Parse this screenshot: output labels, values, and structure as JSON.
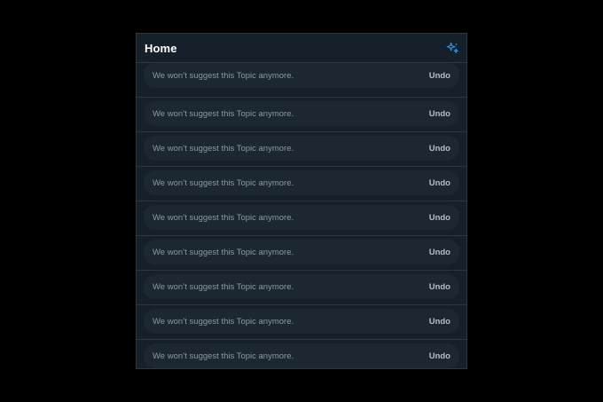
{
  "header": {
    "title": "Home",
    "sparkle_icon": "sparkle-icon",
    "accent_color": "#1d9bf0"
  },
  "notices": [
    {
      "message": "We won’t suggest this Topic anymore.",
      "action": "Undo"
    },
    {
      "message": "We won’t suggest this Topic anymore.",
      "action": "Undo"
    },
    {
      "message": "We won’t suggest this Topic anymore.",
      "action": "Undo"
    },
    {
      "message": "We won’t suggest this Topic anymore.",
      "action": "Undo"
    },
    {
      "message": "We won’t suggest this Topic anymore.",
      "action": "Undo"
    },
    {
      "message": "We won’t suggest this Topic anymore.",
      "action": "Undo"
    },
    {
      "message": "We won’t suggest this Topic anymore.",
      "action": "Undo"
    },
    {
      "message": "We won’t suggest this Topic anymore.",
      "action": "Undo"
    },
    {
      "message": "We won’t suggest this Topic anymore.",
      "action": "Undo"
    }
  ]
}
